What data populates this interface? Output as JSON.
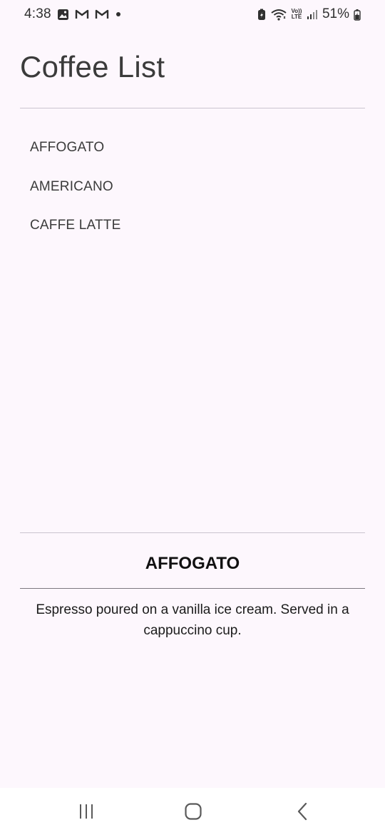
{
  "status_bar": {
    "time": "4:38",
    "battery": "51%",
    "network": "Vo)) LTE",
    "icons": [
      "gallery-icon",
      "gmail-icon",
      "gmail-icon",
      "dot-icon",
      "battery-saver-icon",
      "wifi-icon",
      "volte-icon",
      "signal-icon",
      "battery-icon"
    ]
  },
  "app": {
    "title": "Coffee List"
  },
  "coffee_list": {
    "items": [
      {
        "label": "AFFOGATO"
      },
      {
        "label": "AMERICANO"
      },
      {
        "label": "CAFFE LATTE"
      }
    ]
  },
  "detail": {
    "title": "AFFOGATO",
    "description": "Espresso poured on a vanilla ice cream. Served in a cappuccino cup."
  },
  "nav_bar": {
    "buttons": [
      "recent-apps-icon",
      "home-icon",
      "back-icon"
    ]
  },
  "colors": {
    "background": "#fdf7fd",
    "divider": "#cac4d0",
    "text": "#3b3b3b"
  }
}
